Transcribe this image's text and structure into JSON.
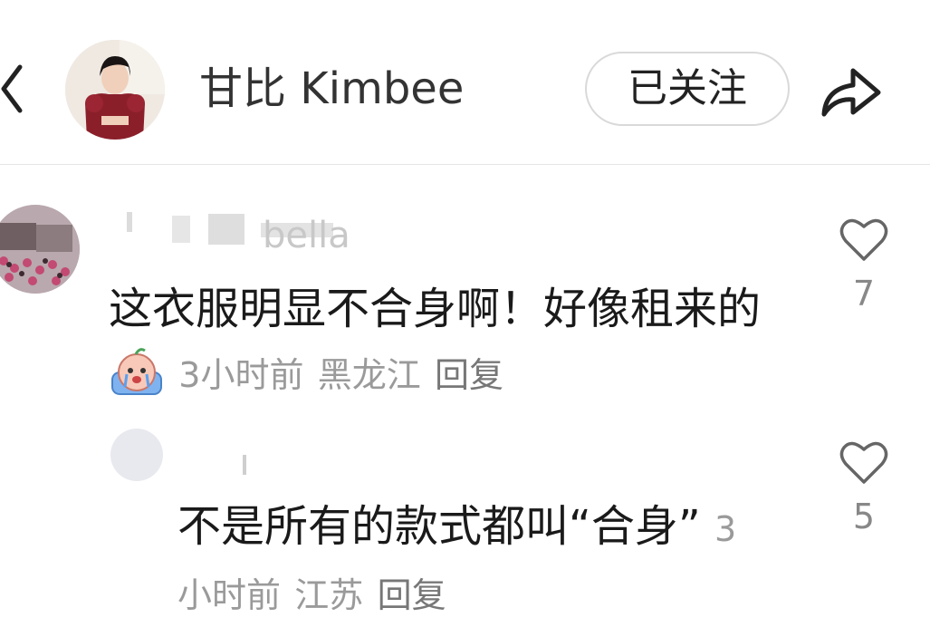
{
  "header": {
    "back_icon": "chevron-left-icon",
    "title": "甘比 Kimbee",
    "follow_label": "已关注",
    "share_icon": "share-arrow-icon"
  },
  "comments": [
    {
      "username_visible": "bella",
      "text": "这衣服明显不合身啊！好像租来的",
      "emoji": "crying-face-emoji",
      "time": "3小时前",
      "location": "黑龙江",
      "reply_label": "回复",
      "like_icon": "heart-outline-icon",
      "likes": "7"
    },
    {
      "text": "不是所有的款式都叫“合身”",
      "time": "3小时前",
      "location": "江苏",
      "reply_label": "回复",
      "like_icon": "heart-outline-icon",
      "likes": "5"
    }
  ],
  "colors": {
    "text_primary": "#1a1a1a",
    "text_meta": "#9a9a9a",
    "border": "#d9d9d9"
  }
}
